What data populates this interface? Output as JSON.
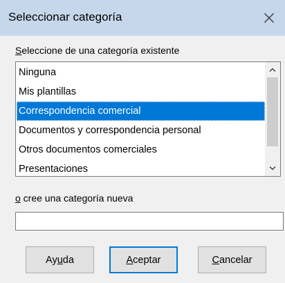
{
  "dialog": {
    "title": "Seleccionar categoría"
  },
  "existing": {
    "label_mnemonic": "S",
    "label_rest": "eleccione de una categoría existente",
    "items": [
      "Ninguna",
      "Mis plantillas",
      "Correspondencia comercial",
      "Documentos y correspondencia personal",
      "Otros documentos comerciales",
      "Presentaciones"
    ],
    "selected_index": 2
  },
  "new_category": {
    "label_mnemonic": "o",
    "label_rest": " cree una categoría nueva",
    "value": ""
  },
  "buttons": {
    "help_pre": "Ay",
    "help_mnemonic": "u",
    "help_post": "da",
    "ok_mnemonic": "A",
    "ok_rest": "ceptar",
    "cancel_mnemonic": "C",
    "cancel_rest": "ancelar"
  },
  "colors": {
    "titlebar": "#c6d7ec",
    "selection": "#0078d7",
    "default_button_border": "#0078d7"
  }
}
